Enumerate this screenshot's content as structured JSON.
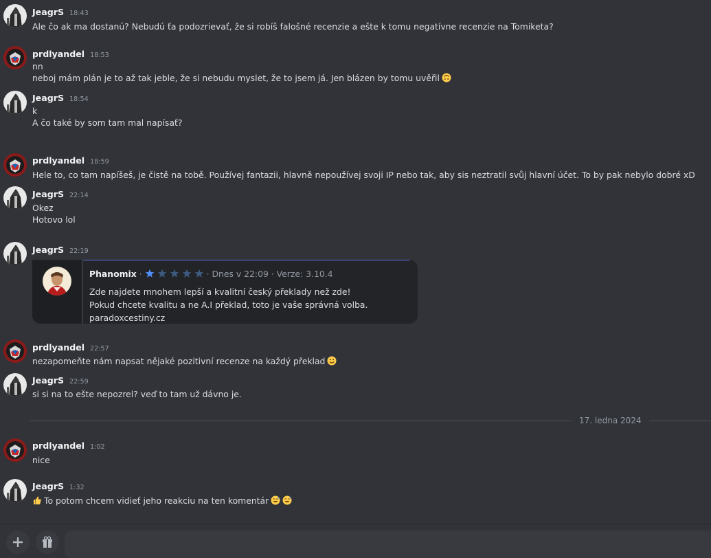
{
  "messages": [
    {
      "user": "JeagrS",
      "time": "18:43",
      "lines": [
        "Ale čo ak ma dostanú? Nebudú ťa podozrievať, že si robíš falošné recenzie a ešte k tomu negatívne recenzie na Tomiketa?"
      ]
    },
    {
      "user": "prdlyandel",
      "time": "18:53",
      "lines": [
        "nn",
        "neboj mám plán je to až tak jeble, že si nebudu myslet, že to jsem já. Jen blázen by tomu uvěřil"
      ]
    },
    {
      "user": "JeagrS",
      "time": "18:54",
      "lines": [
        "k",
        "A čo také by som tam mal napísať?"
      ]
    },
    {
      "user": "prdlyandel",
      "time": "18:59",
      "lines": [
        "Hele to, co tam napíšeš, je čistě na tobě. Používej fantazii, hlavně nepoužívej svoji IP nebo tak, aby sis neztratil svůj hlavní účet. To by pak nebylo dobré xD"
      ]
    },
    {
      "user": "JeagrS",
      "time": "22:14",
      "lines": [
        "Okez",
        "Hotovo lol"
      ]
    },
    {
      "user": "JeagrS",
      "time": "22:19",
      "lines": []
    },
    {
      "user": "prdlyandel",
      "time": "22:57",
      "lines": [
        "nezapomeňte nám napsat nějaké pozitivní recenze na každý překlad"
      ]
    },
    {
      "user": "JeagrS",
      "time": "22:59",
      "lines": [
        "si si na to ešte nepozrel? veď to tam už dávno je."
      ]
    },
    {
      "user": "prdlyandel",
      "time": "1:02",
      "lines": [
        "nice"
      ]
    },
    {
      "user": "JeagrS",
      "time": "1:32",
      "lines": [
        "To potom chcem vidieť jeho reakciu na ten komentár"
      ]
    }
  ],
  "review": {
    "name": "Phanomix",
    "sep": " · ",
    "rating": 1,
    "max_rating": 5,
    "meta": "· Dnes v 22:09 · Verze: 3.10.4",
    "lines": [
      "Zde najdete mnohem lepší a kvalitní český překlady než zde!",
      "Pokud chcete kvalitu a ne A.I překlad, toto je vaše správná volba.",
      "paradoxcestiny.cz"
    ]
  },
  "divider": "17. ledna 2024",
  "icons": {
    "emoji_upside_down": "upside-down-face-icon",
    "emoji_slight_smile": "slightly-smiling-face-icon",
    "emoji_thumbs_up": "thumbs-up-icon",
    "emoji_sweat_smile": "grinning-sweat-icon",
    "add_button": "plus-icon",
    "gift_button": "gift-icon"
  },
  "colors": {
    "background": "#313338",
    "username": "#f2f3f5",
    "timestamp": "#949ba4",
    "star_filled": "#4f8ff7",
    "star_empty": "#3d5a80",
    "embed_accent": "#5b6ee1"
  }
}
